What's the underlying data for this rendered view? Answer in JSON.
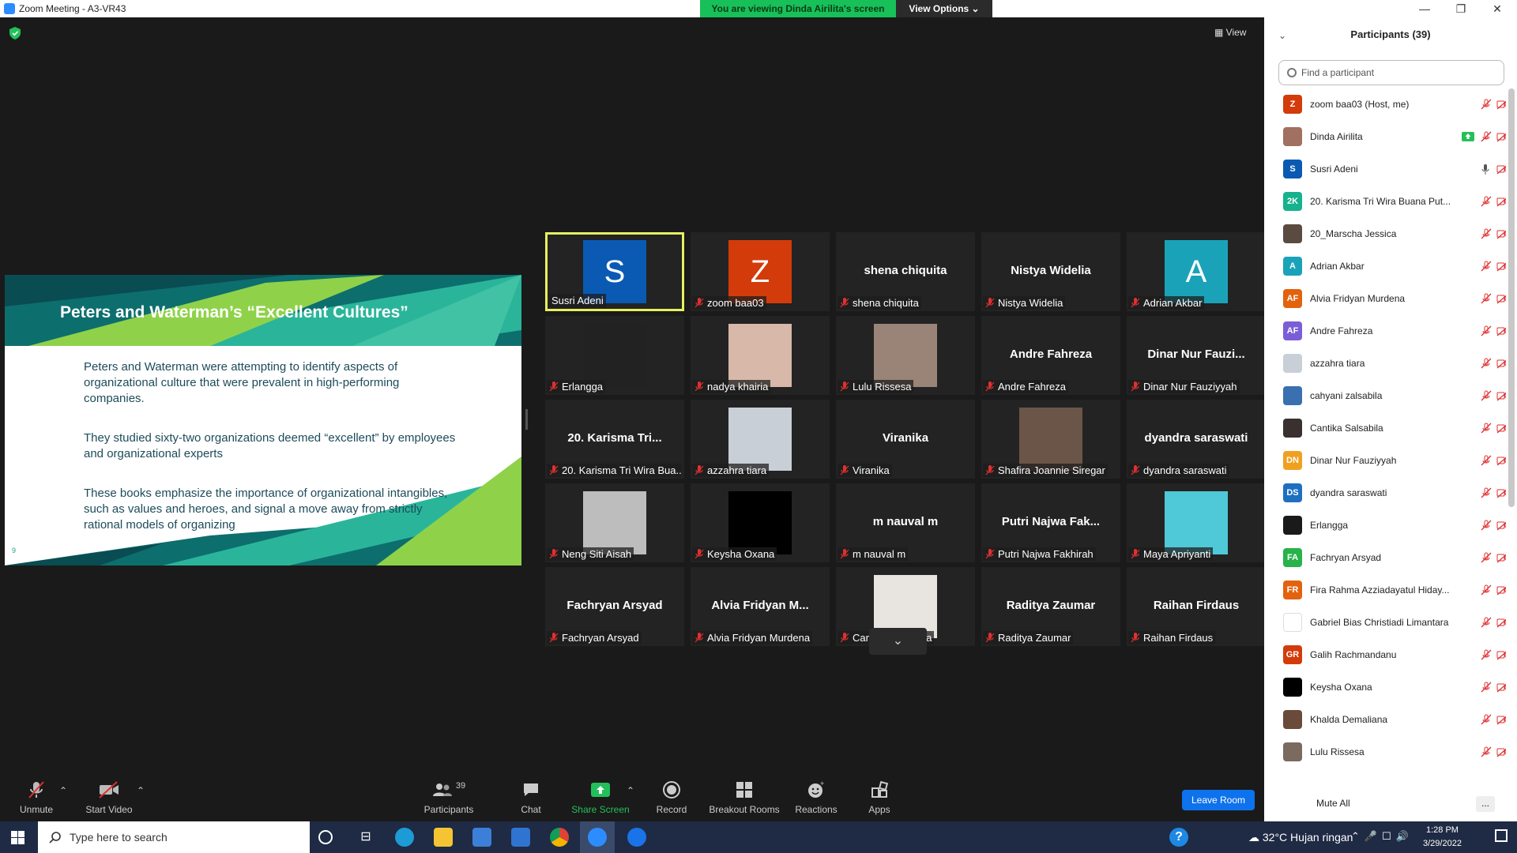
{
  "window": {
    "title": "Zoom Meeting - A3-VR43",
    "minimize": "—",
    "maximize": "❐",
    "close": "✕"
  },
  "viewing": {
    "banner": "You are viewing Dinda Airilita's screen",
    "options": "View Options ⌄"
  },
  "stage": {
    "view_label": "View"
  },
  "slide": {
    "title": "Peters and Waterman’s “Excellent Cultures”",
    "p1": "Peters and Waterman were attempting to identify aspects of organizational culture that were prevalent in high-performing companies.",
    "p2": "They studied sixty-two organizations deemed “excellent” by employees and organizational experts",
    "p3": "These books emphasize the importance of organizational intangibles, such as values and heroes, and signal a move away from strictly rational models of organizing",
    "page": "9"
  },
  "tiles": [
    {
      "kind": "avatar",
      "letter": "S",
      "color": "#0a5ab3",
      "name": "Susri Adeni",
      "active": true,
      "muted": false
    },
    {
      "kind": "avatar",
      "letter": "Z",
      "color": "#d33b0b",
      "name": "zoom baa03",
      "muted": true
    },
    {
      "kind": "text",
      "big": "shena chiquita",
      "name": "shena chiquita",
      "muted": true
    },
    {
      "kind": "text",
      "big": "Nistya Widelia",
      "name": "Nistya Widelia",
      "muted": true
    },
    {
      "kind": "avatar",
      "letter": "A",
      "color": "#1aa3b8",
      "name": "Adrian Akbar",
      "muted": true
    },
    {
      "kind": "photo",
      "photo": "#222",
      "name": "Erlangga",
      "muted": true
    },
    {
      "kind": "photo",
      "photo": "#d8b8a8",
      "name": "nadya khairia",
      "muted": true
    },
    {
      "kind": "photo",
      "photo": "#9a8478",
      "name": "Lulu Rissesa",
      "muted": true
    },
    {
      "kind": "text",
      "big": "Andre Fahreza",
      "name": "Andre Fahreza",
      "muted": true
    },
    {
      "kind": "text",
      "big": "Dinar Nur Fauzi...",
      "name": "Dinar Nur Fauziyyah",
      "muted": true
    },
    {
      "kind": "text",
      "big": "20. Karisma Tri...",
      "name": "20. Karisma Tri Wira Bua...",
      "muted": true
    },
    {
      "kind": "photo",
      "photo": "#c9cfd6",
      "name": "azzahra tiara",
      "muted": true
    },
    {
      "kind": "text",
      "big": "Viranika",
      "name": "Viranika",
      "muted": true
    },
    {
      "kind": "photo",
      "photo": "#6b5548",
      "name": "Shafira Joannie Siregar",
      "muted": true
    },
    {
      "kind": "text",
      "big": "dyandra saraswati",
      "name": "dyandra saraswati",
      "muted": true
    },
    {
      "kind": "photo",
      "photo": "#bdbdbd",
      "name": "Neng Siti Aisah",
      "muted": true
    },
    {
      "kind": "photo",
      "photo": "#000",
      "name": "Keysha Oxana",
      "muted": true
    },
    {
      "kind": "text",
      "big": "m nauval m",
      "name": "m nauval m",
      "muted": true
    },
    {
      "kind": "text",
      "big": "Putri Najwa Fak...",
      "name": "Putri Najwa Fakhirah",
      "muted": true
    },
    {
      "kind": "photo",
      "photo": "#4fc8d8",
      "name": "Maya Apriyanti",
      "muted": true
    },
    {
      "kind": "text",
      "big": "Fachryan Arsyad",
      "name": "Fachryan Arsyad",
      "muted": true
    },
    {
      "kind": "text",
      "big": "Alvia Fridyan M...",
      "name": "Alvia Fridyan Murdena",
      "muted": true
    },
    {
      "kind": "photo",
      "photo": "#e8e4e0",
      "name": "Cantika Salsabila",
      "muted": true
    },
    {
      "kind": "text",
      "big": "Raditya Zaumar",
      "name": "Raditya Zaumar",
      "muted": true
    },
    {
      "kind": "text",
      "big": "Raihan Firdaus",
      "name": "Raihan Firdaus",
      "muted": true
    }
  ],
  "toolbar": {
    "unmute": "Unmute",
    "start_video": "Start Video",
    "participants": "Participants",
    "participants_count": "39",
    "chat": "Chat",
    "share": "Share Screen",
    "record": "Record",
    "breakout": "Breakout Rooms",
    "reactions": "Reactions",
    "apps": "Apps",
    "leave": "Leave Room"
  },
  "panel": {
    "title": "Participants (39)",
    "search_placeholder": "Find a participant",
    "mute_all": "Mute All",
    "more": "...",
    "participants": [
      {
        "name": "zoom baa03 (Host, me)",
        "initials": "Z",
        "color": "#d33b0b",
        "share": false,
        "mic": "muted"
      },
      {
        "name": "Dinda Airilita",
        "initials": "",
        "color": "#a07060",
        "share": true,
        "mic": "muted"
      },
      {
        "name": "Susri Adeni",
        "initials": "S",
        "color": "#0a5ab3",
        "share": false,
        "mic": "on"
      },
      {
        "name": "20. Karisma Tri Wira Buana Put...",
        "initials": "2K",
        "color": "#16b18d",
        "share": false,
        "mic": "muted"
      },
      {
        "name": "20_Marscha Jessica",
        "initials": "",
        "color": "#5a4a40",
        "share": false,
        "mic": "muted"
      },
      {
        "name": "Adrian Akbar",
        "initials": "A",
        "color": "#1aa3b8",
        "share": false,
        "mic": "muted"
      },
      {
        "name": "Alvia Fridyan Murdena",
        "initials": "AF",
        "color": "#e2620e",
        "share": false,
        "mic": "muted"
      },
      {
        "name": "Andre Fahreza",
        "initials": "AF",
        "color": "#7b5ed6",
        "share": false,
        "mic": "muted"
      },
      {
        "name": "azzahra tiara",
        "initials": "",
        "color": "#c9cfd6",
        "share": false,
        "mic": "muted"
      },
      {
        "name": "cahyani zalsabila",
        "initials": "",
        "color": "#3a6fb0",
        "share": false,
        "mic": "muted"
      },
      {
        "name": "Cantika Salsabila",
        "initials": "",
        "color": "#3a3030",
        "share": false,
        "mic": "muted"
      },
      {
        "name": "Dinar Nur Fauziyyah",
        "initials": "DN",
        "color": "#f0a020",
        "share": false,
        "mic": "muted"
      },
      {
        "name": "dyandra saraswati",
        "initials": "DS",
        "color": "#1f6fc0",
        "share": false,
        "mic": "muted"
      },
      {
        "name": "Erlangga",
        "initials": "",
        "color": "#1a1a1a",
        "share": false,
        "mic": "muted"
      },
      {
        "name": "Fachryan Arsyad",
        "initials": "FA",
        "color": "#27b24a",
        "share": false,
        "mic": "muted"
      },
      {
        "name": "Fira Rahma Azziadayatul Hiday...",
        "initials": "FR",
        "color": "#e2620e",
        "share": false,
        "mic": "muted"
      },
      {
        "name": "Gabriel Bias Christiadi Limantara",
        "initials": "",
        "color": "#ffffff",
        "share": false,
        "mic": "muted"
      },
      {
        "name": "Galih Rachmandanu",
        "initials": "GR",
        "color": "#d33b0b",
        "share": false,
        "mic": "muted"
      },
      {
        "name": "Keysha Oxana",
        "initials": "",
        "color": "#000000",
        "share": false,
        "mic": "muted"
      },
      {
        "name": "Khalda Demaliana",
        "initials": "",
        "color": "#6a4a3a",
        "share": false,
        "mic": "muted"
      },
      {
        "name": "Lulu Rissesa",
        "initials": "",
        "color": "#7a6a60",
        "share": false,
        "mic": "muted"
      }
    ]
  },
  "taskbar": {
    "search_placeholder": "Type here to search",
    "weather": "32°C  Hujan ringan",
    "time": "1:28 PM",
    "date": "3/29/2022"
  },
  "colors": {
    "accent": "#0e72ed",
    "active_border": "#e6ef60",
    "share_green": "#18c05a",
    "muted_red": "#e03030"
  }
}
